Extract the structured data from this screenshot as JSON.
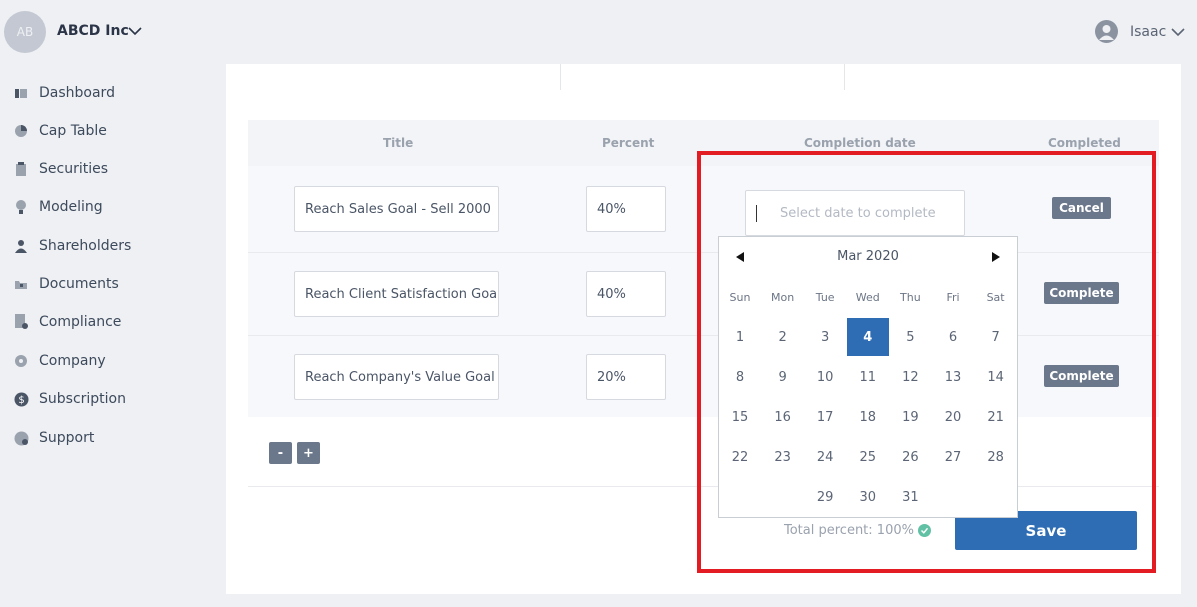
{
  "header": {
    "org_initials": "AB",
    "org_name": "ABCD Inc",
    "user_name": "Isaac"
  },
  "sidebar": {
    "items": [
      {
        "label": "Dashboard",
        "icon": "dashboard-icon"
      },
      {
        "label": "Cap Table",
        "icon": "pie-chart-icon"
      },
      {
        "label": "Securities",
        "icon": "clipboard-icon"
      },
      {
        "label": "Modeling",
        "icon": "lightbulb-icon"
      },
      {
        "label": "Shareholders",
        "icon": "person-icon"
      },
      {
        "label": "Documents",
        "icon": "folder-icon"
      },
      {
        "label": "Compliance",
        "icon": "document-check-icon"
      },
      {
        "label": "Company",
        "icon": "building-icon"
      },
      {
        "label": "Subscription",
        "icon": "dollar-icon"
      },
      {
        "label": "Support",
        "icon": "help-icon"
      }
    ]
  },
  "table": {
    "headers": {
      "title": "Title",
      "percent": "Percent",
      "completion_date": "Completion date",
      "completed": "Completed"
    },
    "rows": [
      {
        "title": "Reach Sales Goal - Sell 2000",
        "percent": "40%",
        "action": "Cancel"
      },
      {
        "title": "Reach Client Satisfaction Goal",
        "percent": "40%",
        "action": "Complete"
      },
      {
        "title": "Reach Company's Value Goal",
        "percent": "20%",
        "action": "Complete"
      }
    ],
    "date_placeholder": "Select date to complete"
  },
  "controls": {
    "remove_label": "-",
    "add_label": "+"
  },
  "footer": {
    "total_text": "Total percent: 100%",
    "save_label": "Save"
  },
  "calendar": {
    "month_title": "Mar 2020",
    "weekdays": [
      "Sun",
      "Mon",
      "Tue",
      "Wed",
      "Thu",
      "Fri",
      "Sat"
    ],
    "weeks": [
      [
        "1",
        "2",
        "3",
        "4",
        "5",
        "6",
        "7"
      ],
      [
        "8",
        "9",
        "10",
        "11",
        "12",
        "13",
        "14"
      ],
      [
        "15",
        "16",
        "17",
        "18",
        "19",
        "20",
        "21"
      ],
      [
        "22",
        "23",
        "24",
        "25",
        "26",
        "27",
        "28"
      ],
      [
        "",
        "",
        "29",
        "30",
        "31",
        "",
        ""
      ]
    ],
    "selected_day": "4"
  },
  "colors": {
    "accent": "#2e6db4",
    "highlight_border": "#e31b23",
    "button_gray": "#6b778b",
    "success": "#61c1a4"
  }
}
